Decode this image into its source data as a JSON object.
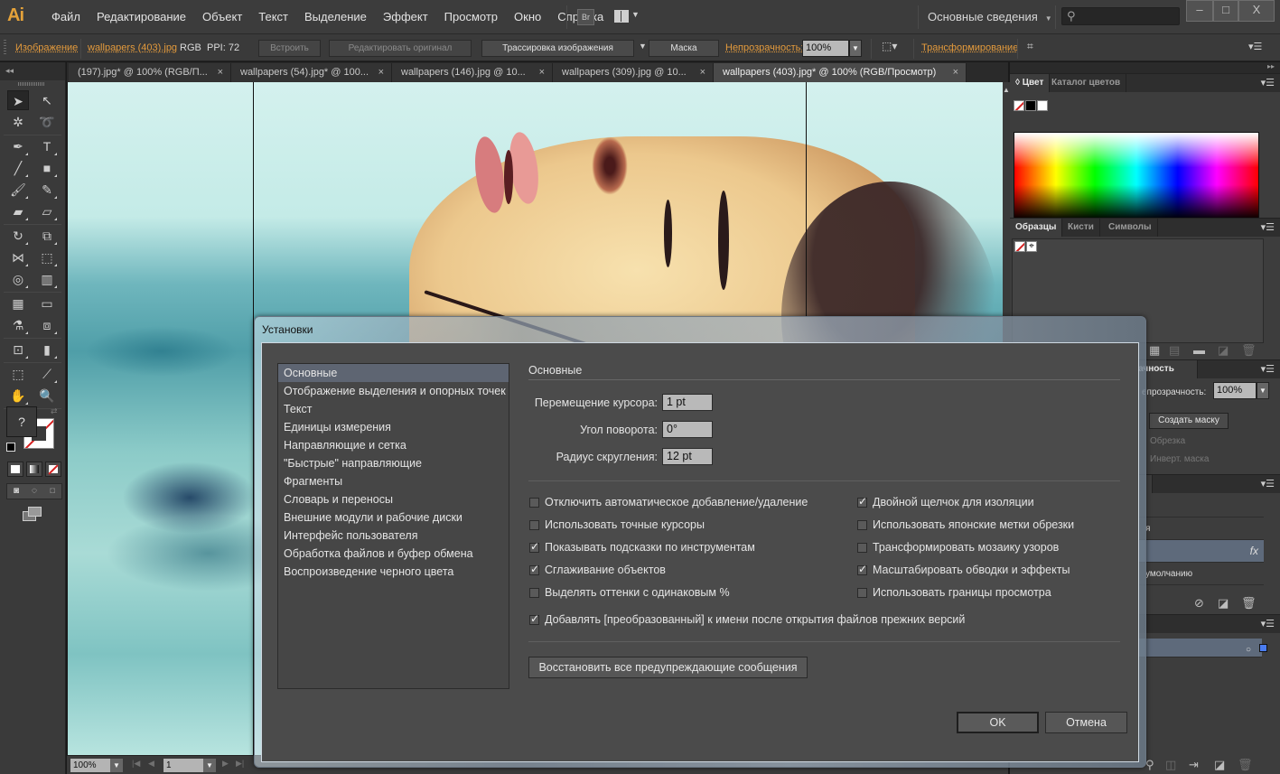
{
  "app": {
    "logo": "Ai",
    "menu": [
      "Файл",
      "Редактирование",
      "Объект",
      "Текст",
      "Выделение",
      "Эффект",
      "Просмотр",
      "Окно",
      "Справка"
    ],
    "bridge_label": "Br",
    "workspace": "Основные сведения",
    "search_placeholder": "",
    "window_controls": {
      "minimize": "–",
      "maximize": "□",
      "close": "X"
    }
  },
  "control_bar": {
    "object_type": "Изображение",
    "file_name": "wallpapers (403).jpg",
    "color_mode": "RGB",
    "ppi": "PPI: 72",
    "embed": "Встроить",
    "edit_original": "Редактировать оригинал",
    "image_trace": "Трассировка изображения",
    "mask": "Маска",
    "opacity_label": "Непрозрачность:",
    "opacity_value": "100%",
    "transform": "Трансформирование"
  },
  "doc_tabs": [
    {
      "label": "(197).jpg* @ 100% (RGB/П...",
      "active": false
    },
    {
      "label": "wallpapers (54).jpg* @ 100...",
      "active": false
    },
    {
      "label": "wallpapers (146).jpg @ 10...",
      "active": false
    },
    {
      "label": "wallpapers (309).jpg @ 10...",
      "active": false
    },
    {
      "label": "wallpapers (403).jpg* @ 100% (RGB/Просмотр)",
      "active": true
    }
  ],
  "status_bar": {
    "zoom": "100%",
    "artboard": "1"
  },
  "tools": {
    "fill_unknown": "?"
  },
  "color_panel": {
    "tabs": [
      "◊ Цвет",
      "Каталог цветов"
    ]
  },
  "swatches_panel": {
    "tabs": [
      "Образцы",
      "Кисти",
      "Символы"
    ]
  },
  "transparency_panel": {
    "tab": "рачность",
    "opacity_label": "епрозрачность:",
    "opacity_value": "100%",
    "make_mask": "Создать маску",
    "clip": "Обрезка",
    "invert_mask": "Инверт. маска"
  },
  "graphic_styles_panel": {
    "tab": "и",
    "rows": [
      "",
      "я",
      "",
      "умолчанию"
    ],
    "fx": "fx"
  },
  "dialog": {
    "title": "Установки",
    "categories": [
      "Основные",
      "Отображение выделения и опорных точек",
      "Текст",
      "Единицы измерения",
      "Направляющие и сетка",
      "\"Быстрые\" направляющие",
      "Фрагменты",
      "Словарь и переносы",
      "Внешние модули и рабочие диски",
      "Интерфейс пользователя",
      "Обработка файлов и буфер обмена",
      "Воспроизведение черного цвета"
    ],
    "selected_category": "Основные",
    "section_title": "Основные",
    "fields": [
      {
        "label": "Перемещение курсора:",
        "value": "1 pt"
      },
      {
        "label": "Угол поворота:",
        "value": "0°"
      },
      {
        "label": "Радиус скругления:",
        "value": "12 pt"
      }
    ],
    "checkboxes_left": [
      {
        "label": "Отключить автоматическое добавление/удаление",
        "checked": false
      },
      {
        "label": "Использовать точные курсоры",
        "checked": false
      },
      {
        "label": "Показывать подсказки по инструментам",
        "checked": true
      },
      {
        "label": "Сглаживание объектов",
        "checked": true
      },
      {
        "label": "Выделять оттенки с одинаковым %",
        "checked": false
      }
    ],
    "checkboxes_right": [
      {
        "label": "Двойной щелчок для изоляции",
        "checked": true
      },
      {
        "label": "Использовать японские метки обрезки",
        "checked": false
      },
      {
        "label": "Трансформировать мозаику узоров",
        "checked": false
      },
      {
        "label": "Масштабировать обводки и эффекты",
        "checked": true
      },
      {
        "label": "Использовать границы просмотра",
        "checked": false
      }
    ],
    "checkbox_wide": {
      "label": "Добавлять [преобразованный] к имени после открытия файлов прежних версий",
      "checked": true
    },
    "reset_warnings": "Восстановить все предупреждающие сообщения",
    "ok": "OK",
    "cancel": "Отмена"
  },
  "colors": {
    "accent_orange": "#e39a3c",
    "selection_blue": "#5e6572",
    "none_red": "#d62020"
  }
}
